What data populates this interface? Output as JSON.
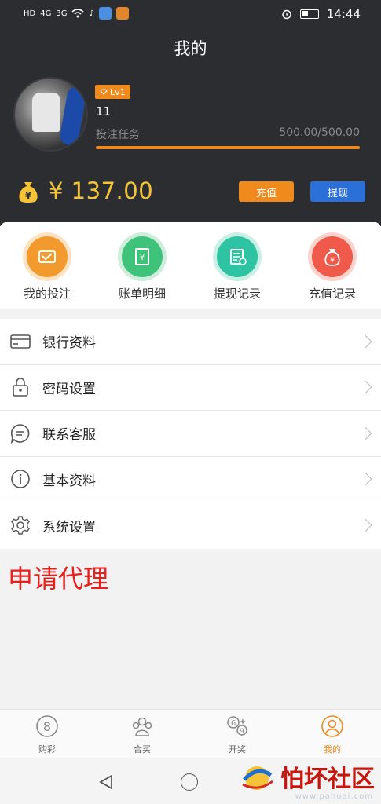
{
  "status_bar": {
    "time": "14:44",
    "left_icons": [
      "HD",
      "4G",
      "3G",
      "wifi-icon",
      "tiktok-icon"
    ]
  },
  "header": {
    "title": "我的",
    "level": "Lv1",
    "username": "11",
    "task_label": "投注任务",
    "task_value": "500.00/500.00",
    "task_progress": 1.0,
    "currency": "¥",
    "balance": "¥ 137.00",
    "recharge_label": "充值",
    "withdraw_label": "提现"
  },
  "quick_actions": [
    {
      "label": "我的投注",
      "icon": "my-bets-icon",
      "color": "#f29a2e"
    },
    {
      "label": "账单明细",
      "icon": "bill-details-icon",
      "color": "#3fc27a"
    },
    {
      "label": "提现记录",
      "icon": "withdraw-record-icon",
      "color": "#2ec3a2"
    },
    {
      "label": "充值记录",
      "icon": "recharge-record-icon",
      "color": "#f05a4a"
    }
  ],
  "menu": [
    {
      "label": "银行资料",
      "icon": "bank-card-icon"
    },
    {
      "label": "密码设置",
      "icon": "lock-icon"
    },
    {
      "label": "联系客服",
      "icon": "chat-icon"
    },
    {
      "label": "基本资料",
      "icon": "info-icon"
    },
    {
      "label": "系统设置",
      "icon": "gear-icon"
    }
  ],
  "agent_link": "申请代理",
  "tabs": [
    {
      "label": "购彩",
      "icon": "lottery-icon",
      "active": false
    },
    {
      "label": "合买",
      "icon": "group-buy-icon",
      "active": false
    },
    {
      "label": "开奖",
      "icon": "draw-results-icon",
      "active": false
    },
    {
      "label": "我的",
      "icon": "profile-icon",
      "active": true
    }
  ],
  "watermark": {
    "text": "怕坏社区",
    "url": "www.pahuai.com"
  },
  "colors": {
    "header_bg": "#2b2d30",
    "accent_orange": "#f08a1c",
    "accent_blue": "#2b6fd8",
    "balance_gold": "#f5c336",
    "agent_red": "#e8201c"
  }
}
